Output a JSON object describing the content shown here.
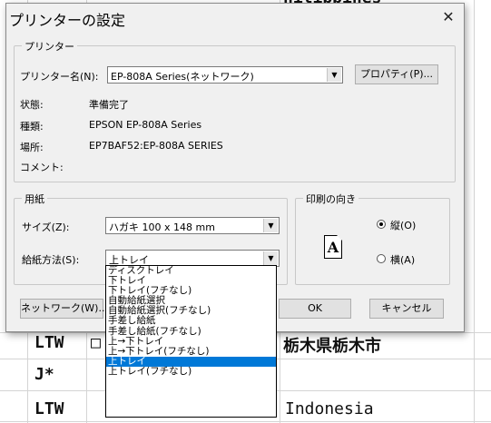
{
  "dialog": {
    "title": "プリンターの設定",
    "close_glyph": "✕",
    "printer_group": {
      "label": "プリンター",
      "name_label": "プリンター名(N):",
      "name_value": "EP-808A Series(ネットワーク)",
      "properties_button": "プロパティ(P)...",
      "status_label": "状態:",
      "status_value": "準備完了",
      "type_label": "種類:",
      "type_value": "EPSON EP-808A Series",
      "where_label": "場所:",
      "where_value": "EP7BAF52:EP-808A SERIES",
      "comment_label": "コメント:"
    },
    "paper_group": {
      "label": "用紙",
      "size_label": "サイズ(Z):",
      "size_value": "ハガキ 100 x 148 mm",
      "source_label": "給紙方法(S):",
      "source_value": "上トレイ",
      "source_options": [
        "ディスクトレイ",
        "下トレイ",
        "下トレイ(フチなし)",
        "自動給紙選択",
        "自動給紙選択(フチなし)",
        "手差し給紙",
        "手差し給紙(フチなし)",
        "上→下トレイ",
        "上→下トレイ(フチなし)",
        "上トレイ",
        "上トレイ(フチなし)"
      ],
      "selected_index": 9
    },
    "orientation_group": {
      "label": "印刷の向き",
      "icon_letter": "A",
      "portrait_label": "縦(O)",
      "landscape_label": "横(A)",
      "selected": "portrait"
    },
    "buttons": {
      "network": "ネットワーク(W)...",
      "ok": "OK",
      "cancel": "キャンセル"
    }
  },
  "background": {
    "cells": [
      "hilippines",
      "LTW",
      "□",
      "栃木県栃木市",
      "J*",
      "LTW",
      "Indonesia"
    ]
  }
}
